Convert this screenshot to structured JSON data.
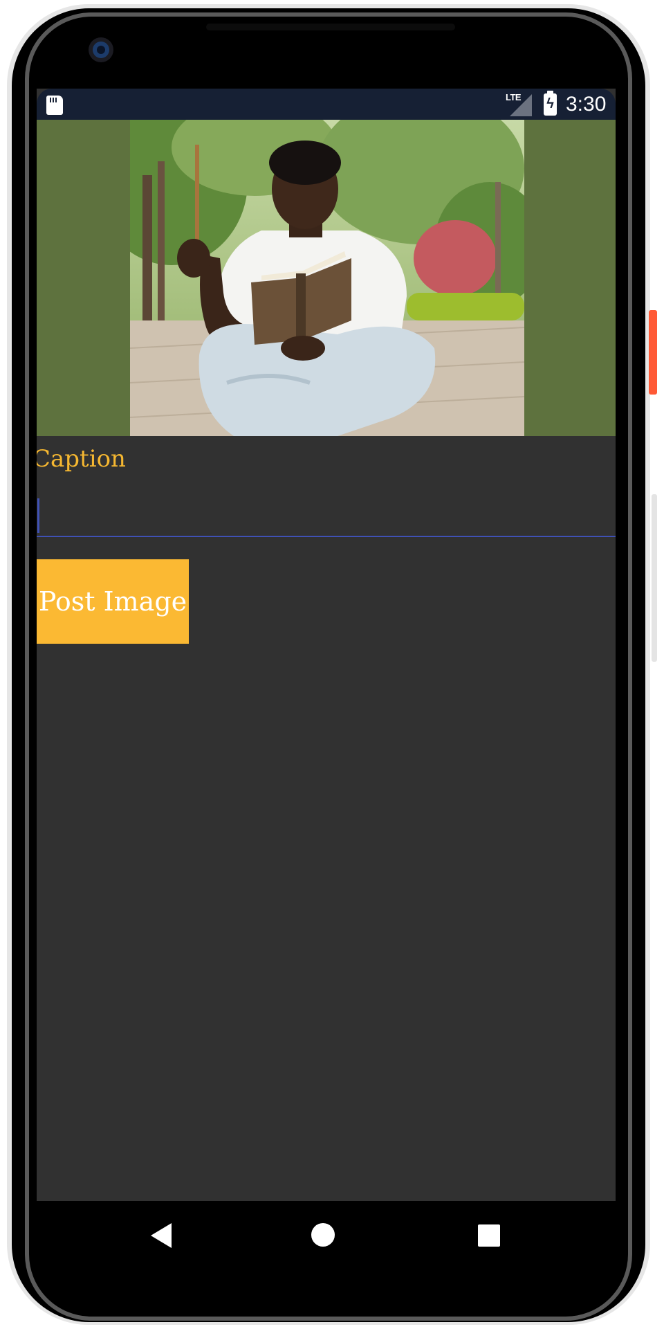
{
  "status_bar": {
    "network": "LTE",
    "time": "3:30"
  },
  "form": {
    "caption_label": "Caption",
    "caption_value": "",
    "post_button_label": "Post Image"
  },
  "colors": {
    "accent": "#fbb933",
    "image_background": "#5e723e",
    "screen_background": "#313131",
    "status_bar": "#162034",
    "input_underline": "#3f51b5"
  },
  "icons": {
    "status_left": "sd-card-icon",
    "signal": "signal-icon",
    "battery": "battery-charging-icon",
    "nav": [
      "back-icon",
      "home-icon",
      "recents-icon"
    ]
  }
}
